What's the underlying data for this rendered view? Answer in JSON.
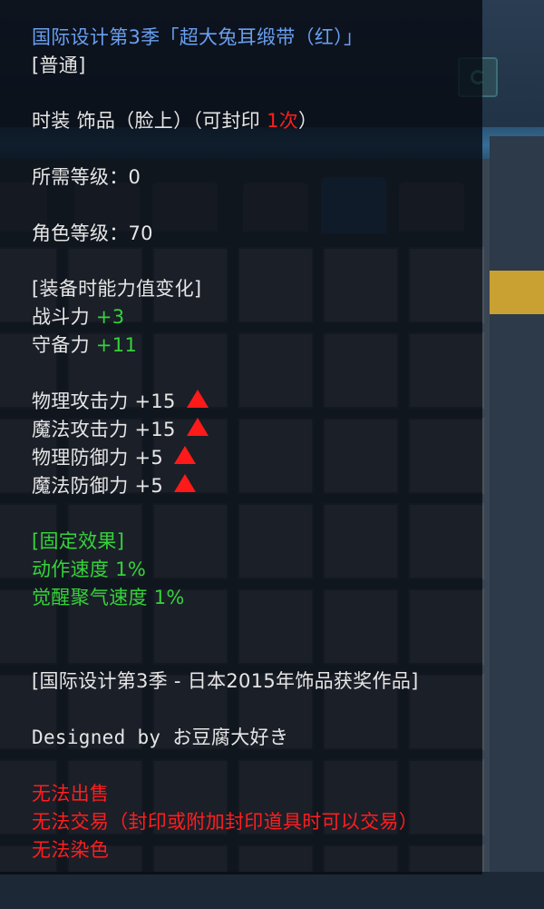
{
  "item": {
    "name": "国际设计第3季「超大兔耳缎带（红）」",
    "rarity": "[普通]",
    "type_prefix": "时装 饰品（脸上）（可封印 ",
    "seal_count": "1次",
    "type_suffix": "）",
    "required_level": "所需等级：0",
    "character_level": "角色等级：70"
  },
  "stats": {
    "header": "[装备时能力值变化]",
    "combat_power_label": "战斗力",
    "combat_power_value": "+3",
    "defense_power_label": "守备力",
    "defense_power_value": "+11",
    "attributes": [
      {
        "label": "物理攻击力 +15",
        "change": "up"
      },
      {
        "label": "魔法攻击力 +15",
        "change": "up"
      },
      {
        "label": "物理防御力 +5",
        "change": "up"
      },
      {
        "label": "魔法防御力 +5",
        "change": "up"
      }
    ]
  },
  "fixed_effect": {
    "header": "[固定效果]",
    "lines": [
      "动作速度 1%",
      "觉醒聚气速度 1%"
    ]
  },
  "description": {
    "award": "[国际设计第3季 - 日本2015年饰品获奖作品]",
    "designer": "Designed by お豆腐大好き"
  },
  "restrictions": [
    "无法出售",
    "无法交易（封印或附加封印道具时可以交易）",
    "无法染色"
  ],
  "colors": {
    "name": "#6a9ff0",
    "text": "#e6e6e6",
    "positive": "#35d33a",
    "restriction": "#ff1e1e",
    "stat_up_icon": "#ff1a1a"
  }
}
